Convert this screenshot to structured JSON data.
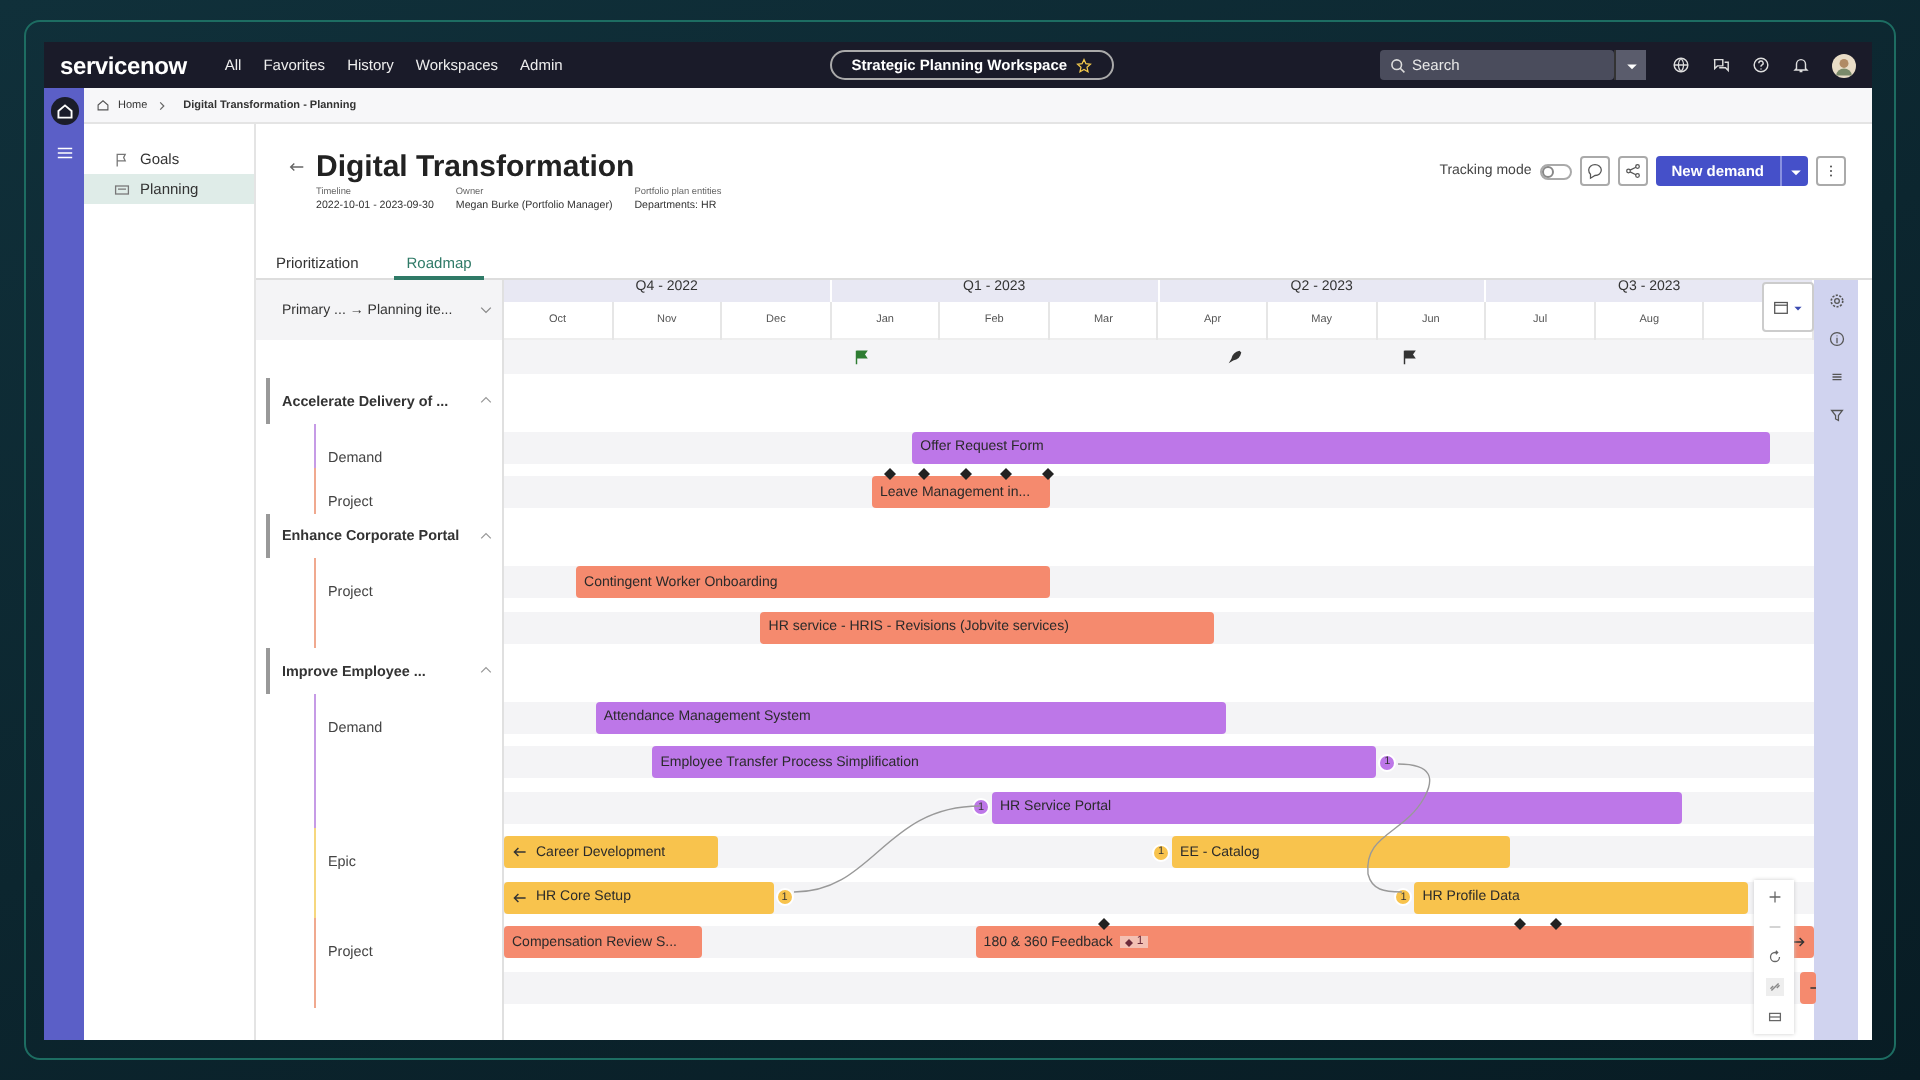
{
  "topbar": {
    "logo": "servicenow",
    "nav": [
      "All",
      "Favorites",
      "History",
      "Workspaces",
      "Admin"
    ],
    "workspace": "Strategic Planning Workspace",
    "search": {
      "placeholder": "Search"
    }
  },
  "breadcrumb": [
    "Home",
    "Digital Transformation - Planning"
  ],
  "sidebar": {
    "items": [
      {
        "label": "Goals",
        "selected": false
      },
      {
        "label": "Planning",
        "selected": true
      }
    ]
  },
  "header": {
    "title": "Digital Transformation",
    "fields": [
      {
        "label": "Timeline",
        "value": "2022-10-01 - 2023-09-30"
      },
      {
        "label": "Owner",
        "value": "Megan Burke (Portfolio Manager)"
      },
      {
        "label": "Portfolio plan entities",
        "value": "Departments: HR"
      }
    ],
    "tracking_mode": {
      "label": "Tracking mode",
      "on": false
    },
    "primary_button": "New demand"
  },
  "tabs": [
    {
      "label": "Prioritization",
      "selected": false
    },
    {
      "label": "Roadmap",
      "selected": true
    }
  ],
  "roadmap": {
    "grouping": "Primary ... → Planning ite...",
    "quarters": [
      "Q4 - 2022",
      "Q1 - 2023",
      "Q2 - 2023",
      "Q3 - 2023"
    ],
    "months": [
      "Oct",
      "Nov",
      "Dec",
      "Jan",
      "Feb",
      "Mar",
      "Apr",
      "May",
      "Jun",
      "Jul",
      "Aug"
    ],
    "groups": [
      {
        "title": "Accelerate Delivery of ...",
        "expanded": true,
        "types": [
          {
            "label": "Demand",
            "kind": "demand",
            "rows": [
              [
                {
                  "label": "Offer Request Form"
                }
              ]
            ]
          },
          {
            "label": "Project",
            "kind": "project",
            "rows": [
              [
                {
                  "label": "Leave Management in..."
                }
              ]
            ]
          }
        ]
      },
      {
        "title": "Enhance Corporate Portal",
        "expanded": true,
        "types": [
          {
            "label": "Project",
            "kind": "project",
            "rows": [
              [
                {
                  "label": "Contingent Worker Onboarding"
                }
              ],
              [
                {
                  "label": "HR service - HRIS - Revisions (Jobvite services)"
                }
              ]
            ]
          }
        ]
      },
      {
        "title": "Improve Employee ...",
        "expanded": true,
        "types": [
          {
            "label": "Demand",
            "kind": "demand",
            "rows": [
              [
                {
                  "label": "Attendance Management System"
                }
              ],
              [
                {
                  "label": "Employee Transfer Process Simplification",
                  "badge_after": "1"
                }
              ],
              [
                {
                  "label": "HR Service Portal",
                  "badge_before": "1"
                }
              ]
            ]
          },
          {
            "label": "Epic",
            "kind": "epic",
            "rows": [
              [
                {
                  "label": "Career Development",
                  "starts_before": true
                },
                {
                  "label": "EE - Catalog",
                  "badge_before": "1"
                }
              ],
              [
                {
                  "label": "HR Core Setup",
                  "starts_before": true,
                  "badge_after": "1"
                },
                {
                  "label": "HR Profile Data",
                  "badge_before": "1"
                }
              ]
            ]
          },
          {
            "label": "Project",
            "kind": "project",
            "rows": [
              [
                {
                  "label": "Compensation Review S..."
                },
                {
                  "label": "180 & 360 Feedback",
                  "tag": "1",
                  "continues": true
                }
              ],
              [
                {
                  "continues": true
                }
              ]
            ]
          }
        ]
      }
    ]
  }
}
